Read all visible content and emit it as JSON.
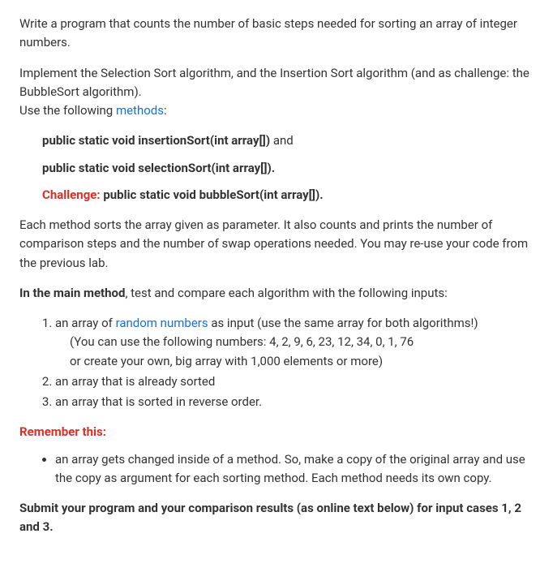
{
  "intro_p1": "Write a program that counts the number of basic steps needed for sorting an array of integer numbers.",
  "intro_p2a": "Implement the Selection Sort algorithm, and the Insertion Sort algorithm (and as challenge: the BubbleSort algorithm).",
  "intro_p2b_prefix": "Use the following ",
  "intro_p2b_link": "methods",
  "intro_p2b_suffix": ":",
  "sig1_text": "public static void insertionSort(int array[])",
  "sig1_suffix": " and",
  "sig2_text": "public static void selectionSort(int array[]).",
  "challenge_label": "Challenge:",
  "sig3_text": " public static void bubbleSort(int array[]).",
  "each_method_para": "Each method sorts the array given as parameter. It also counts and prints the number of comparison steps and the number of swap operations needed. You may re-use your code from the previous lab.",
  "main_method_label": "In the main method",
  "main_method_rest": ", test and compare each algorithm with the following inputs:",
  "li1_prefix": "an array of ",
  "li1_link": "random numbers",
  "li1_suffix": " as input (use the same array for both algorithms!)",
  "li1_note1": "(You can use the following numbers: 4, 2, 9, 6, 23, 12, 34, 0, 1, 76",
  "li1_note2": "or create your own, big array with 1,000 elements or more)",
  "li2": "an array that is already sorted",
  "li3": "an array that is sorted in reverse order.",
  "remember_label": "Remember this:",
  "bullet1": "an array gets changed inside of a method. So, make a copy of the original array and use the copy as argument for each sorting method.  Each method needs its own copy.",
  "submit_text": "Submit your program and your comparison results (as online text below) for input cases 1, 2 and 3."
}
